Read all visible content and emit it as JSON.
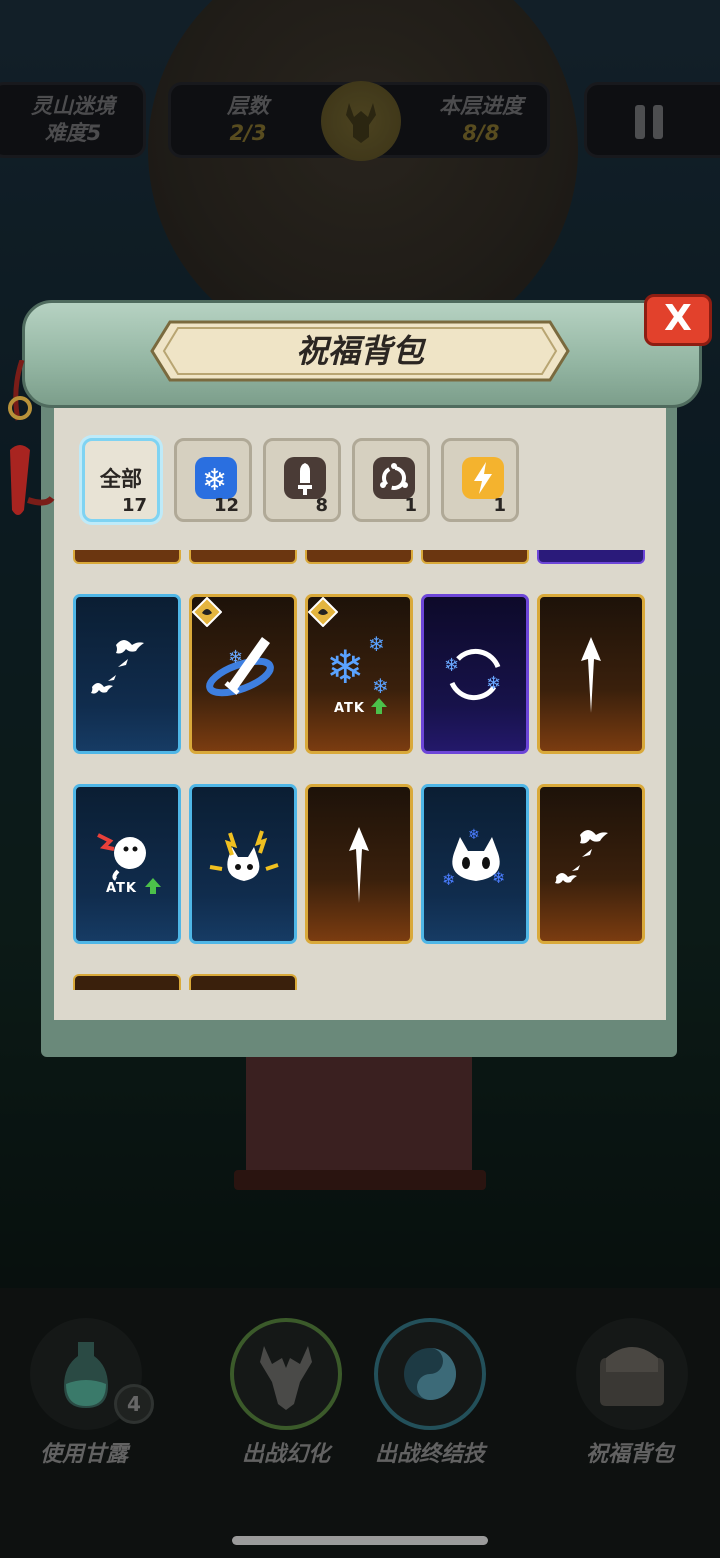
{
  "hud": {
    "realm": {
      "title": "灵山迷境",
      "sub": "难度5"
    },
    "floors": {
      "title": "层数",
      "sub": "2/3"
    },
    "progress": {
      "title": "本层进度",
      "sub": "8/8"
    }
  },
  "panel": {
    "title": "祝福背包",
    "close_label": "X"
  },
  "tabs": [
    {
      "label": "全部",
      "count": "17",
      "icon": "all",
      "active": true
    },
    {
      "label": "",
      "count": "12",
      "icon": "snowflake-icon",
      "active": false
    },
    {
      "label": "",
      "count": "8",
      "icon": "sword-icon",
      "active": false
    },
    {
      "label": "",
      "count": "1",
      "icon": "orbit-icon",
      "active": false
    },
    {
      "label": "",
      "count": "1",
      "icon": "lightning-icon",
      "active": false
    }
  ],
  "cards": [
    {
      "row": 1,
      "rarity": "blue",
      "icon": "birds-icon",
      "atk": false,
      "badge": false
    },
    {
      "row": 1,
      "rarity": "gold",
      "icon": "ice-sword-icon",
      "atk": false,
      "badge": true
    },
    {
      "row": 1,
      "rarity": "gold",
      "icon": "snowflake-icon",
      "atk": true,
      "badge": true
    },
    {
      "row": 1,
      "rarity": "purple",
      "icon": "orbit-icon",
      "atk": false,
      "badge": false
    },
    {
      "row": 1,
      "rarity": "gold",
      "icon": "arrow-up-icon",
      "atk": false,
      "badge": false
    },
    {
      "row": 2,
      "rarity": "blue",
      "icon": "angry-face-icon",
      "atk": true,
      "badge": false
    },
    {
      "row": 2,
      "rarity": "blue",
      "icon": "horned-lightning-icon",
      "atk": false,
      "badge": false
    },
    {
      "row": 2,
      "rarity": "gold",
      "icon": "arrow-up-icon",
      "atk": false,
      "badge": false
    },
    {
      "row": 2,
      "rarity": "blue",
      "icon": "horned-frost-icon",
      "atk": false,
      "badge": false
    },
    {
      "row": 2,
      "rarity": "gold",
      "icon": "birds-icon",
      "atk": false,
      "badge": false
    }
  ],
  "atk_label": "ATK",
  "bottom": {
    "nectar": {
      "label": "使用甘露",
      "count": "4"
    },
    "transform": {
      "label": "出战幻化"
    },
    "finisher": {
      "label": "出战终结技"
    },
    "bag": {
      "label": "祝福背包"
    }
  },
  "colors": {
    "blue_border": "#4fb6e6",
    "gold_border": "#d9a93a",
    "purple_border": "#6d46d8",
    "close_red": "#e2412c"
  }
}
